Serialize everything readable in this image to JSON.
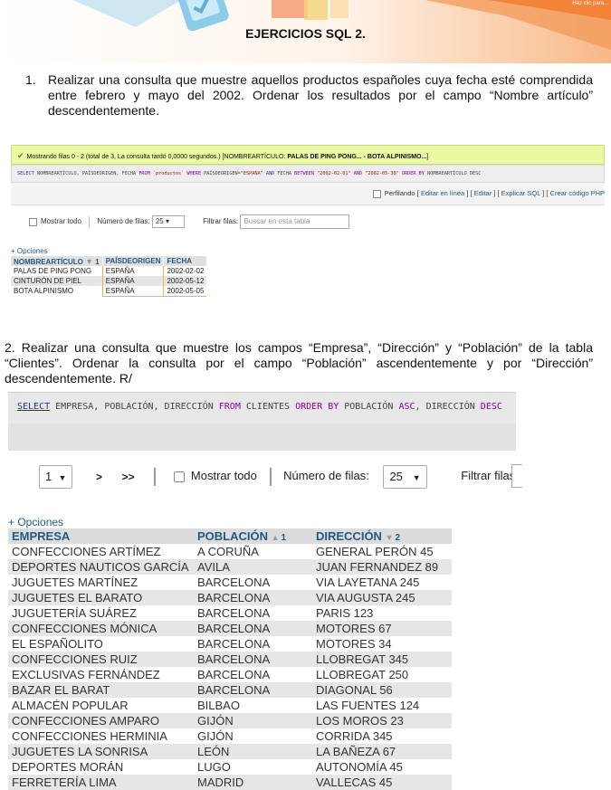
{
  "page": {
    "title": "EJERCICIOS SQL 2.",
    "banner_fragment": "Haz clic para..."
  },
  "q1": {
    "number": "1.",
    "text": "Realizar una consulta que muestre aquellos productos españoles cuya fecha esté comprendida entre febrero y mayo del 2002. Ordenar los resultados por el campo “Nombre artículo” descendentemente."
  },
  "pma1": {
    "success_text": "Mostrando filas 0 - 2 (total de 3, La consulta tardó 0,0000 segundos.) [NOMBREARTÍCULO: ",
    "success_bold": "PALAS DE PING PONG... - BOTA ALPINISMO...",
    "success_end": "]",
    "sql_select": "SELECT",
    "sql_p1": " NOMBREARTÍCULO, PAÍSDEORIGEN, FECHA ",
    "sql_from": "FROM",
    "sql_table": " `productos` ",
    "sql_where": "WHERE",
    "sql_p2": " PAÍSDEORIGEN=",
    "sql_s1": "\"ESPAÑA\"",
    "sql_and": " AND ",
    "sql_p3": "FECHA ",
    "sql_between": "BETWEEN",
    "sql_s2": " \"2002-02-01\" ",
    "sql_and2": "AND",
    "sql_s3": " \"2002-05-30\" ",
    "sql_order": "ORDER BY",
    "sql_p4": " NOMBREARTÍCULO DESC",
    "profiling": "Perfilando",
    "link_inline": "Editar en línea",
    "link_edit": "Editar",
    "link_explain": "Explicar SQL",
    "link_code": "Crear código PHP",
    "show_all": "Mostrar todo",
    "rows_label": "Número de filas:",
    "rows_value": "25",
    "filter_label": "Filtrar filas:",
    "filter_placeholder": "Buscar en esta tabla",
    "options": "+ Opciones",
    "columns": [
      "NOMBREARTÍCULO",
      "PAÍSDEORIGEN",
      "FECHA"
    ],
    "sort_indicator": "1",
    "rows": [
      [
        "PALAS DE PING PONG",
        "ESPAÑA",
        "2002-02-02"
      ],
      [
        "CINTURÓN DE PIEL",
        "ESPAÑA",
        "2002-05-12"
      ],
      [
        "BOTA ALPINISMO",
        "ESPAÑA",
        "2002-05-05"
      ]
    ]
  },
  "q2": {
    "text": "2. Realizar una consulta que muestre los campos “Empresa”, “Dirección” y “Población” de la tabla “Clientes”. Ordenar la consulta por el campo “Población” ascendentemente y por “Dirección” descendentemente. R/"
  },
  "pma2": {
    "sql_select": "SELECT",
    "sql_p1": " EMPRESA, POBLACIÓN, DIRECCIÓN ",
    "sql_from": "FROM",
    "sql_p2": " CLIENTES ",
    "sql_order": "ORDER BY",
    "sql_p3": " POBLACIÓN ",
    "sql_asc": "ASC",
    "sql_p4": ", DIRECCIÓN ",
    "sql_desc": "DESC",
    "page_value": "1",
    "next": ">",
    "last": ">>",
    "show_all": "Mostrar todo",
    "rows_label": "Número de filas:",
    "rows_value": "25",
    "filter_label": "Filtrar filas:",
    "options": "+ Opciones",
    "col_empresa": "EMPRESA",
    "col_poblacion": "POBLACIÓN",
    "col_poblacion_sort": "1",
    "col_direccion": "DIRECCIÓN",
    "col_direccion_sort": "2",
    "rows": [
      [
        "CONFECCIONES ARTÍMEZ",
        "A CORUÑA",
        "GENERAL PERÓN 45"
      ],
      [
        "DEPORTES NAUTICOS GARCÍA",
        "AVILA",
        "JUAN FERNANDEZ 89"
      ],
      [
        "JUGUETES MARTÍNEZ",
        "BARCELONA",
        "VIA LAYETANA 245"
      ],
      [
        "JUGUETES EL BARATO",
        "BARCELONA",
        "VIA AUGUSTA 245"
      ],
      [
        "JUGUETERÍA SUÁREZ",
        "BARCELONA",
        "PARIS 123"
      ],
      [
        "CONFECCIONES MÓNICA",
        "BARCELONA",
        "MOTORES 67"
      ],
      [
        "EL ESPAÑOLITO",
        "BARCELONA",
        "MOTORES 34"
      ],
      [
        "CONFECCIONES RUIZ",
        "BARCELONA",
        "LLOBREGAT 345"
      ],
      [
        "EXCLUSIVAS FERNÁNDEZ",
        "BARCELONA",
        "LLOBREGAT 250"
      ],
      [
        "BAZAR EL BARAT",
        "BARCELONA",
        "DIAGONAL 56"
      ],
      [
        "ALMACÉN POPULAR",
        "BILBAO",
        "LAS FUENTES 124"
      ],
      [
        "CONFECCIONES AMPARO",
        "GIJÓN",
        "LOS MOROS 23"
      ],
      [
        "CONFECCIONES HERMINIA",
        "GIJÓN",
        "CORRIDA 345"
      ],
      [
        "JUGUETES LA SONRISA",
        "LEÓN",
        "LA BAÑEZA 67"
      ],
      [
        "DEPORTES MORÁN",
        "LUGO",
        "AUTONOMÍA 45"
      ],
      [
        "FERRETERÍA LIMA",
        "MADRID",
        "VALLECAS 45"
      ]
    ]
  }
}
